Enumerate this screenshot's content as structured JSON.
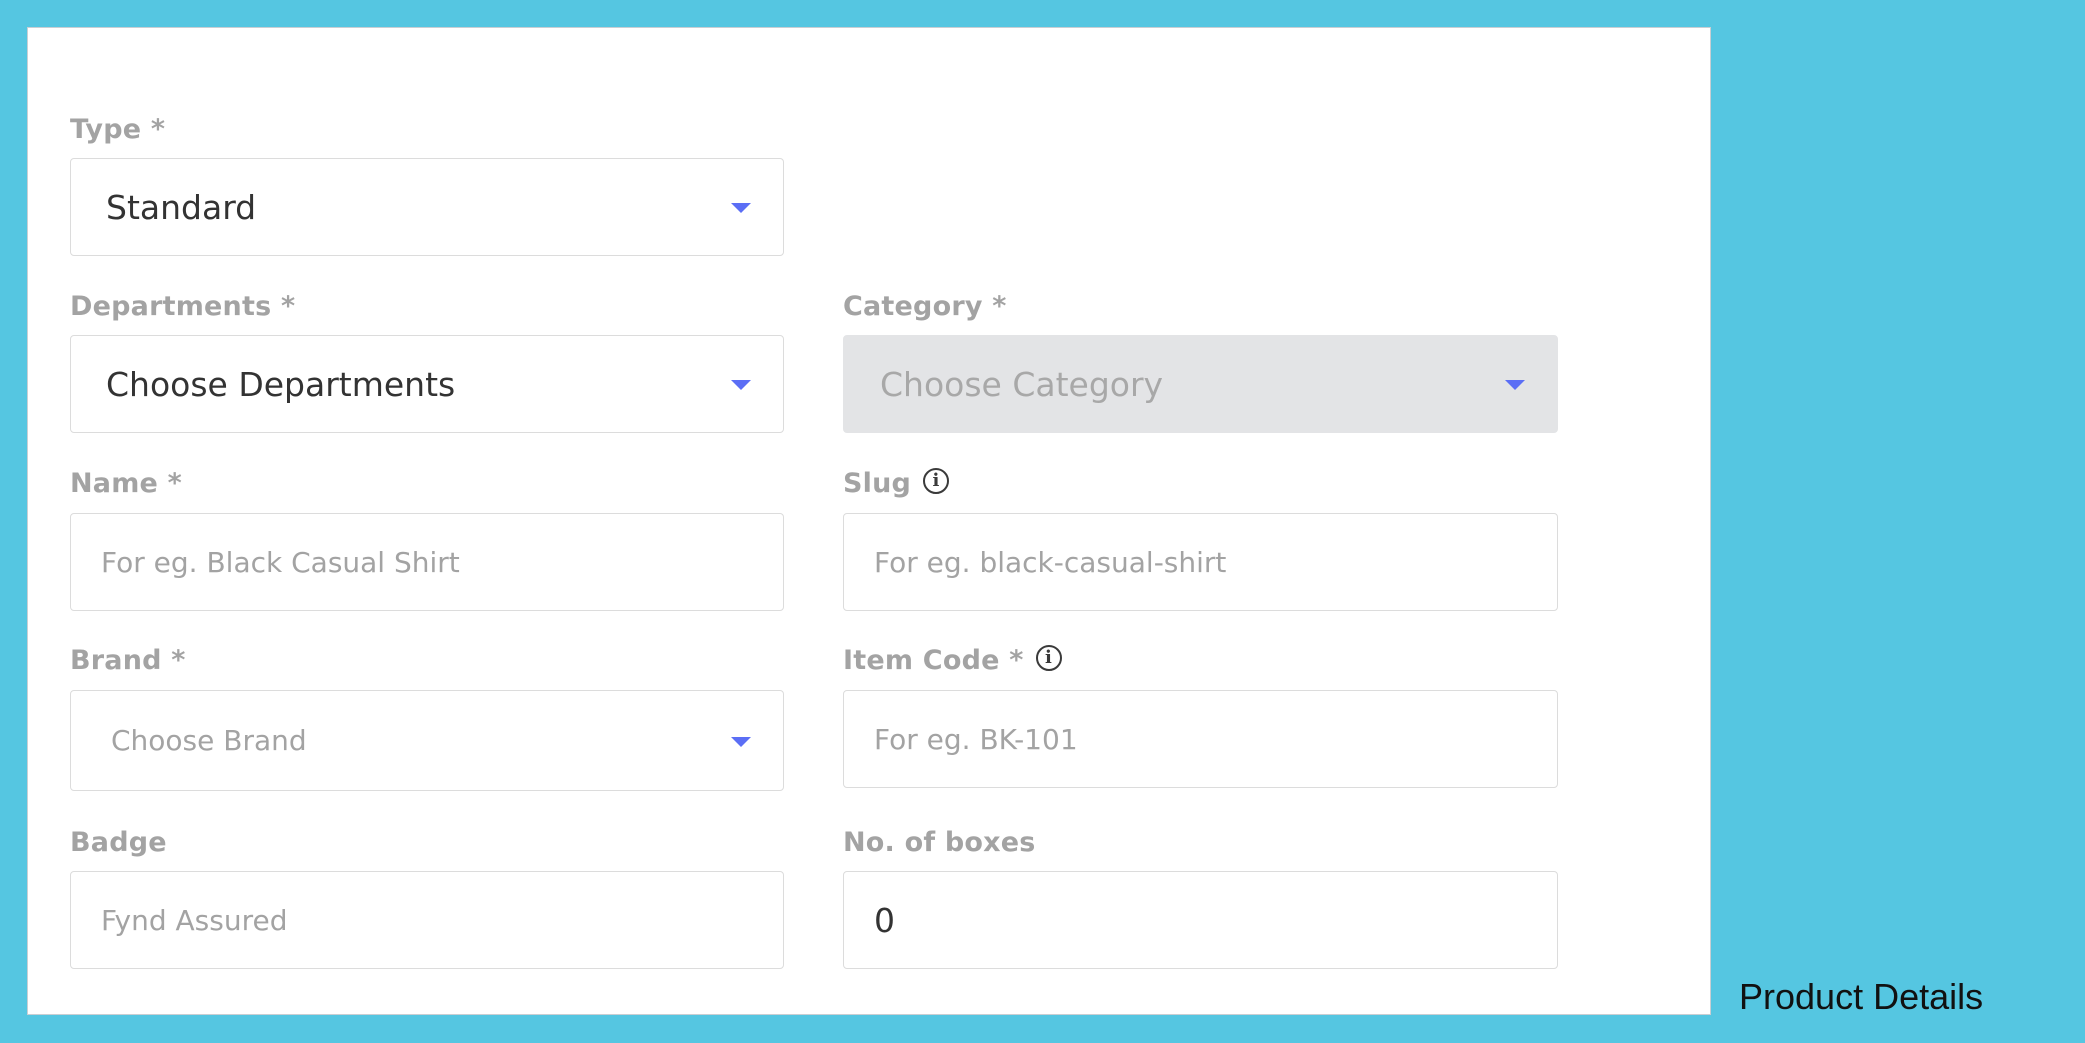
{
  "form": {
    "type": {
      "label": "Type *",
      "value": "Standard"
    },
    "departments": {
      "label": "Departments *",
      "value": "Choose Departments"
    },
    "category": {
      "label": "Category *",
      "value": "Choose Category"
    },
    "name": {
      "label": "Name *",
      "placeholder": "For eg. Black Casual Shirt"
    },
    "slug": {
      "label": "Slug",
      "info_icon": "info-circle-icon",
      "placeholder": "For eg. black-casual-shirt"
    },
    "brand": {
      "label": "Brand *",
      "value": "Choose Brand"
    },
    "item_code": {
      "label": "Item Code *",
      "info_icon": "info-circle-icon",
      "placeholder": "For eg. BK-101"
    },
    "badge": {
      "label": "Badge",
      "placeholder": "Fynd Assured"
    },
    "boxes": {
      "label": "No. of boxes",
      "value": "0"
    }
  },
  "caption": "Product Details",
  "colors": {
    "background": "#55c6e1",
    "caret": "#5b6ef5",
    "disabled_field": "#e3e4e6"
  }
}
